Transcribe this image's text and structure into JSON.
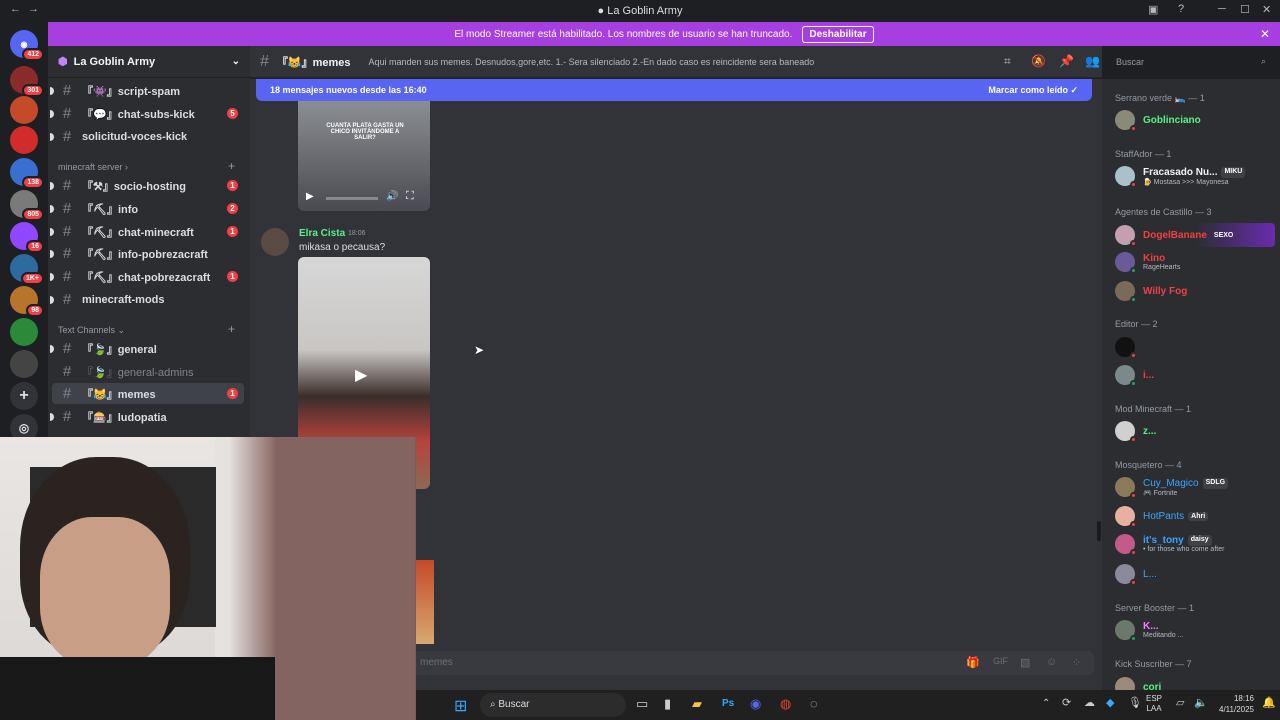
{
  "window": {
    "title": "La Goblin Army"
  },
  "banner": {
    "text": "El modo Streamer está habilitado. Los nombres de usuario se han truncado.",
    "button": "Deshabilitar"
  },
  "servers": [
    {
      "badge": "412"
    },
    {
      "badge": "301"
    },
    {
      "badge": ""
    },
    {
      "badge": ""
    },
    {
      "badge": "138"
    },
    {
      "badge": "805"
    },
    {
      "badge": "16"
    },
    {
      "badge": "1K+"
    },
    {
      "badge": "98"
    },
    {
      "badge": ""
    },
    {
      "badge": ""
    }
  ],
  "sidebar": {
    "guild_name": "La Goblin Army",
    "channels_top": [
      {
        "name": "『👾』script-spam",
        "count": ""
      },
      {
        "name": "『💬』chat-subs-kick",
        "count": "5"
      },
      {
        "name": "solicitud-voces-kick",
        "count": ""
      }
    ],
    "category1": "minecraft server",
    "channels_mc": [
      {
        "name": "『⚒』socio-hosting",
        "count": "1"
      },
      {
        "name": "『⛏』info",
        "count": "2"
      },
      {
        "name": "『⛏』chat-minecraft",
        "count": "1"
      },
      {
        "name": "『⛏』info-pobrezacraft",
        "count": ""
      },
      {
        "name": "『⛏』chat-pobrezacraft",
        "count": "1"
      },
      {
        "name": "minecraft-mods",
        "count": ""
      }
    ],
    "category2": "Text Channels",
    "channels_text": [
      {
        "name": "『🍃』general",
        "count": ""
      },
      {
        "name": "『🍃』general-admins",
        "count": ""
      },
      {
        "name": "『😹』memes",
        "count": "1"
      },
      {
        "name": "『🎰』ludopatia",
        "count": ""
      }
    ]
  },
  "header": {
    "channel": "『😹』memes",
    "topic": "Aqui manden sus memes. Desnudos,gore,etc. 1.- Sera silenciado 2.-En dado caso es reincidente sera baneado",
    "search_placeholder": "Buscar"
  },
  "new_messages": {
    "text": "18 mensajes nuevos desde las 16:40",
    "action": "Marcar como leído"
  },
  "messages": [
    {
      "author": "Elra Cista",
      "time": "18:06",
      "text": "mikasa o  pecausa?"
    }
  ],
  "video_caption": "CUANTA PLATA GASTA UN CHICO INVITÁNDOME A SALIR?",
  "composer_placeholder": "memes",
  "members": {
    "groups": [
      {
        "title": "Serrano verde 🛌 — 1",
        "members": [
          {
            "name": "Goblinciano",
            "sub": "",
            "color": "#57f287",
            "tag": ""
          }
        ]
      },
      {
        "title": "StaffAdor — 1",
        "members": [
          {
            "name": "Fracasado Nu...",
            "sub": "🍺 Mostasa >>> Mayonesa",
            "color": "#f2f3f5",
            "tag": "MIKU"
          }
        ]
      },
      {
        "title": "Agentes de Castillo — 3",
        "members": [
          {
            "name": "DogelBanane",
            "sub": "",
            "color": "#f23f43",
            "tag": "SEXO"
          },
          {
            "name": "Kino",
            "sub": "RageHearts",
            "color": "#f23f43",
            "tag": ""
          },
          {
            "name": "Willy Fog",
            "sub": "",
            "color": "#f23f43",
            "tag": ""
          }
        ]
      },
      {
        "title": "Editor — 2",
        "members": [
          {
            "name": "",
            "sub": "",
            "color": "#f23f43",
            "tag": ""
          },
          {
            "name": "i...",
            "sub": "",
            "color": "#f23f43",
            "tag": ""
          }
        ]
      },
      {
        "title": "Mod Minecraft — 1",
        "members": [
          {
            "name": "z...",
            "sub": "",
            "color": "#57f287",
            "tag": ""
          }
        ]
      },
      {
        "title": "Mosquetero — 4",
        "members": [
          {
            "name": "Cuy_Magico",
            "sub": "🎮 Fortnite",
            "color": "#3ba5ff",
            "tag": "SDLG"
          },
          {
            "name": "HotPants",
            "sub": "",
            "color": "#3ba5ff",
            "tag": "Ahri"
          },
          {
            "name": "it's_tony",
            "sub": "• for those who come after",
            "color": "#3ba5ff",
            "tag": "daisy"
          },
          {
            "name": "L...",
            "sub": "",
            "color": "#3ba5ff",
            "tag": ""
          }
        ]
      },
      {
        "title": "Server Booster — 1",
        "members": [
          {
            "name": "K...",
            "sub": "Meditando ...",
            "color": "#f47fff",
            "tag": ""
          }
        ]
      },
      {
        "title": "Kick Suscriber — 7",
        "members": [
          {
            "name": "cori",
            "sub": "",
            "color": "#57f287",
            "tag": ""
          }
        ]
      }
    ]
  },
  "taskbar": {
    "search": "Buscar",
    "lang": "ESP",
    "lang2": "LAA",
    "time": "18:16",
    "date": "4/11/2025"
  }
}
